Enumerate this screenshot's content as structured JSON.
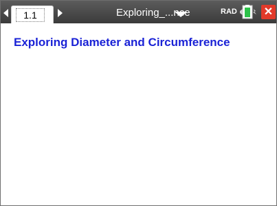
{
  "titlebar": {
    "tab_label": "1.1",
    "document_title": "Exploring_...nce",
    "angle_mode": "RAD"
  },
  "content": {
    "heading": "Exploring Diameter and Circumference"
  },
  "colors": {
    "titlebar_background": "#4a4a4a",
    "heading": "#1a22d6",
    "battery": "#2ec24a",
    "close_button": "#e23a2a"
  },
  "icons": {
    "previous_page": "triangle-left",
    "next_page": "triangle-right",
    "document_menu": "triangle-down",
    "battery": "battery-charging",
    "close": "x"
  }
}
